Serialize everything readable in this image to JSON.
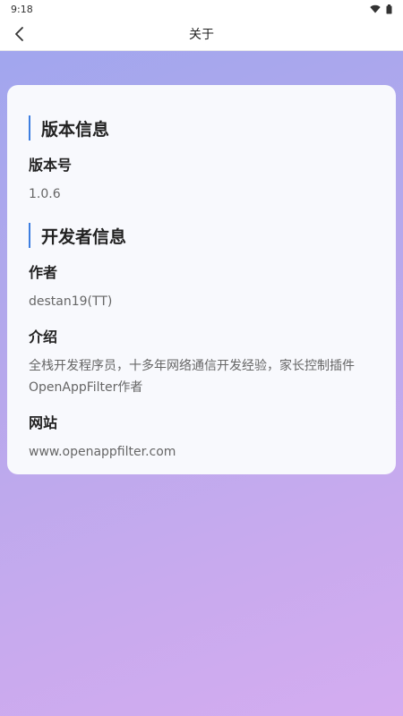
{
  "status_bar": {
    "time": "9:18"
  },
  "app_bar": {
    "title": "关于"
  },
  "version_section": {
    "title": "版本信息",
    "version_label": "版本号",
    "version_value": "1.0.6"
  },
  "developer_section": {
    "title": "开发者信息",
    "author_label": "作者",
    "author_value": "destan19(TT)",
    "intro_label": "介绍",
    "intro_value": "全栈开发程序员，十多年网络通信开发经验，家长控制插件OpenAppFilter作者",
    "website_label": "网站",
    "website_value": "www.openappfilter.com"
  },
  "colors": {
    "accent_bar": "#3d7ee0"
  },
  "icons": {
    "back": "chevron-left-icon",
    "wifi": "wifi-icon",
    "battery": "battery-icon"
  }
}
